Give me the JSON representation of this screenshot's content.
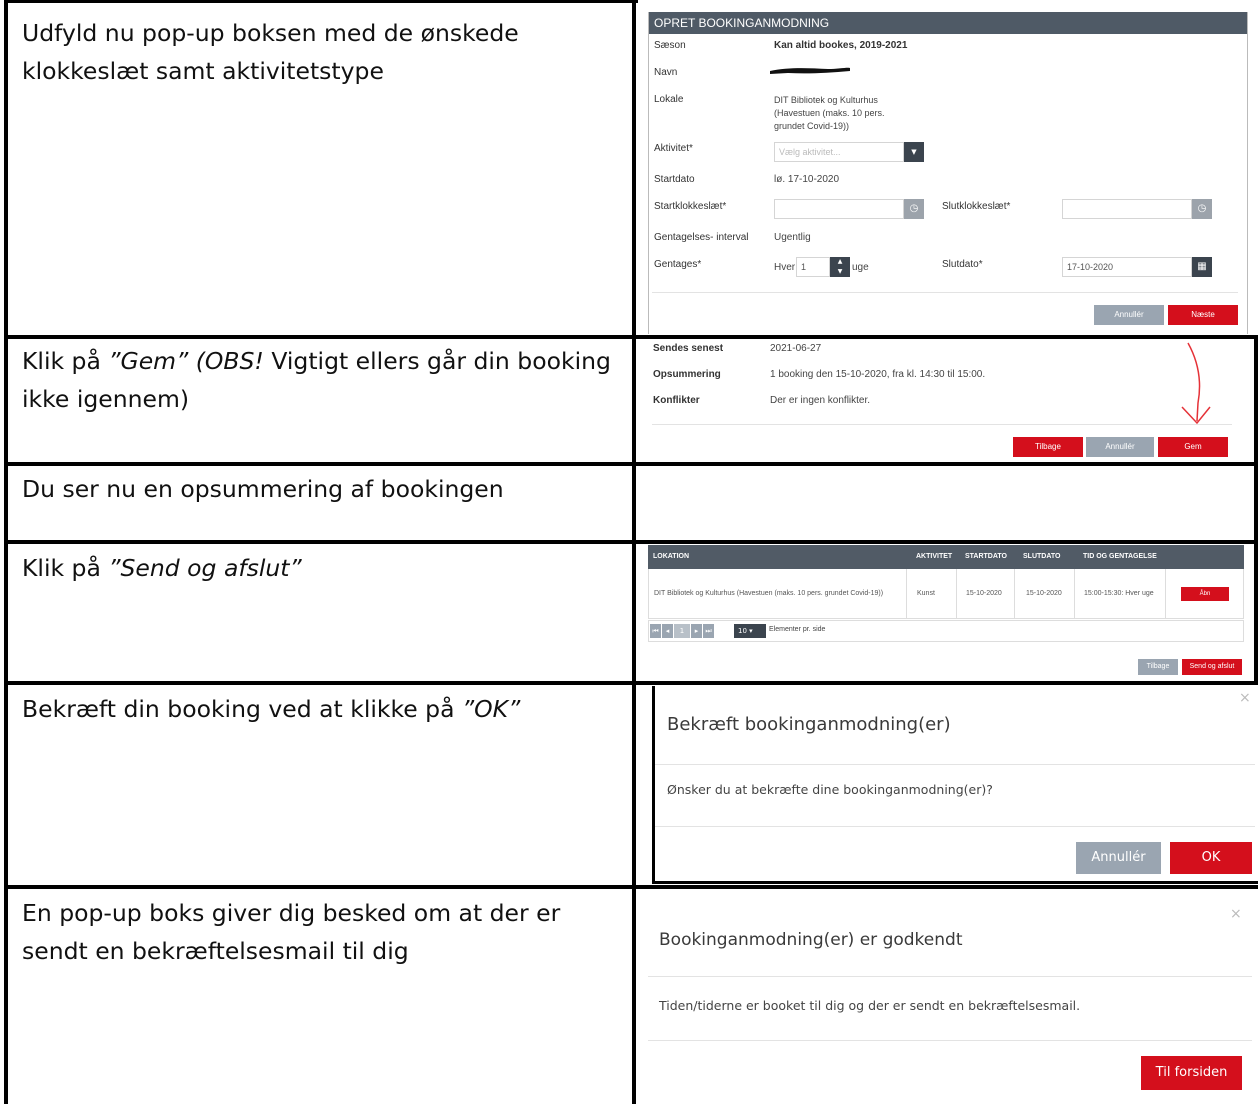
{
  "rows": [
    {
      "instruction": "Udfyld nu pop-up boksen med de ønskede klokkeslæt samt aktivitetstype"
    },
    {
      "instruction_a": "Klik på ",
      "instruction_b": "”Gem” (OBS!",
      "instruction_c": " Vigtigt ellers går din booking ikke igennem)"
    },
    {
      "instruction": "Du ser nu en opsummering af bookingen"
    },
    {
      "instruction_a": "Klik på ",
      "instruction_b": "”Send og afslut”"
    },
    {
      "instruction_a": "Bekræft din booking ved at klikke på ",
      "instruction_b": "”OK”"
    },
    {
      "instruction": "En pop-up boks giver dig besked om at der er sendt en bekræftelsesmail til dig"
    }
  ],
  "form": {
    "header": "OPRET BOOKINGANMODNING",
    "season_label": "Sæson",
    "season_value": "Kan altid bookes, 2019-2021",
    "name_label": "Navn",
    "location_label": "Lokale",
    "location_value": "DIT Bibliotek og Kulturhus (Havestuen (maks. 10 pers. grundet Covid-19))",
    "activity_label": "Aktivitet*",
    "activity_placeholder": "Vælg aktivitet...",
    "startdate_label": "Startdato",
    "startdate_value": "lø. 17-10-2020",
    "starttime_label": "Startklokkeslæt*",
    "endtime_label": "Slutklokkeslæt*",
    "interval_label": "Gentagelses- interval",
    "interval_value": "Ugentlig",
    "repeat_label": "Gentages*",
    "repeat_every": "Hver",
    "repeat_value": "1",
    "repeat_unit": "uge",
    "enddate_label": "Slutdato*",
    "enddate_value": "17-10-2020",
    "cancel": "Annullér",
    "next": "Næste"
  },
  "summary": {
    "send_label": "Sendes senest",
    "send_value": "2021-06-27",
    "summary_label": "Opsummering",
    "summary_value": "1 booking den 15-10-2020, fra kl. 14:30 til 15:00.",
    "conflict_label": "Konflikter",
    "conflict_value": "Der er ingen konflikter.",
    "back": "Tilbage",
    "cancel": "Annullér",
    "save": "Gem"
  },
  "table": {
    "headers": [
      "LOKATION",
      "AKTIVITET",
      "STARTDATO",
      "SLUTDATO",
      "TID OG GENTAGELSE"
    ],
    "row": [
      "DIT Bibliotek og Kulturhus (Havestuen (maks. 10 pers. grundet Covid-19))",
      "Kunst",
      "15-10-2020",
      "15-10-2020",
      "15:00-15:30: Hver uge"
    ],
    "open": "Åbn",
    "page": "1",
    "per_page_value": "10",
    "per_page_label": "Elementer pr. side",
    "back": "Tilbage",
    "send": "Send og afslut"
  },
  "confirm": {
    "title": "Bekræft bookinganmodning(er)",
    "text": "Ønsker du at bekræfte dine bookinganmodning(er)?",
    "cancel": "Annullér",
    "ok": "OK"
  },
  "approved": {
    "title": "Bookinganmodning(er) er godkendt",
    "text": "Tiden/tiderne er booket til dig og der er sendt en bekræftelsesmail.",
    "home": "Til forsiden"
  },
  "colors": {
    "red": "#d40f1c",
    "grey_button": "#9aa5b1",
    "header": "#4f5a66"
  },
  "icons": [
    "clock-icon",
    "calendar-icon",
    "chevron-down-icon",
    "close-icon",
    "arrow-icon"
  ]
}
